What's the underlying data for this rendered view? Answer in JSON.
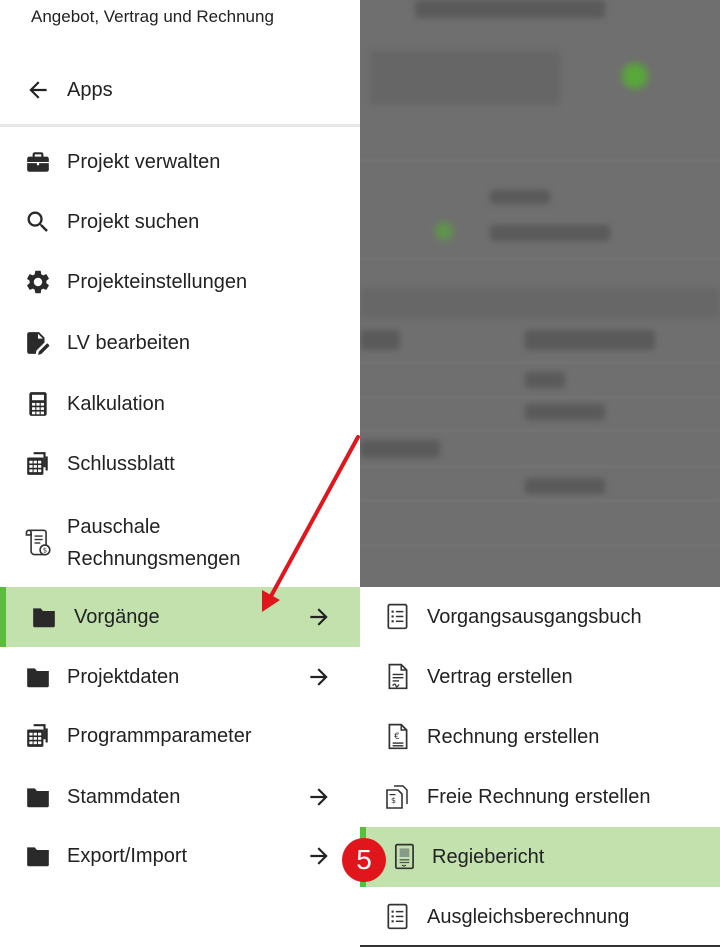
{
  "drawer": {
    "app_title": "Angebot, Vertrag und Rechnung",
    "back_label": "Apps",
    "items": [
      {
        "label": "Projekt verwalten",
        "icon": "briefcase-icon"
      },
      {
        "label": "Projekt suchen",
        "icon": "search-icon"
      },
      {
        "label": "Projekteinstellungen",
        "icon": "gear-icon"
      },
      {
        "label": "LV bearbeiten",
        "icon": "document-edit-icon"
      },
      {
        "label": "Kalkulation",
        "icon": "calculator-icon"
      },
      {
        "label": "Schlussblatt",
        "icon": "sheet-stack-icon"
      },
      {
        "label": "Pauschale Rechnungsmengen",
        "icon": "scroll-money-icon"
      },
      {
        "label": "Vorgänge",
        "icon": "folder-icon",
        "active": true,
        "has_submenu": true
      },
      {
        "label": "Projektdaten",
        "icon": "folder-icon",
        "has_submenu": true
      },
      {
        "label": "Programmparameter",
        "icon": "sheet-stack-icon"
      },
      {
        "label": "Stammdaten",
        "icon": "folder-icon",
        "has_submenu": true
      },
      {
        "label": "Export/Import",
        "icon": "folder-icon",
        "has_submenu": true
      }
    ]
  },
  "submenu": {
    "items": [
      {
        "label": "Vorgangsausgangsbuch",
        "icon": "list-document-icon"
      },
      {
        "label": "Vertrag erstellen",
        "icon": "contract-document-icon"
      },
      {
        "label": "Rechnung erstellen",
        "icon": "euro-document-icon"
      },
      {
        "label": "Freie Rechnung erstellen",
        "icon": "multi-invoice-icon"
      },
      {
        "label": "Regiebericht",
        "icon": "report-document-icon",
        "active": true
      },
      {
        "label": "Ausgleichsberechnung",
        "icon": "list-document-icon"
      }
    ]
  },
  "annotation": {
    "step_number": "5",
    "color": "#e0161c"
  },
  "colors": {
    "active_bg": "#c2e1ad",
    "active_accent": "#5bbd3c"
  }
}
